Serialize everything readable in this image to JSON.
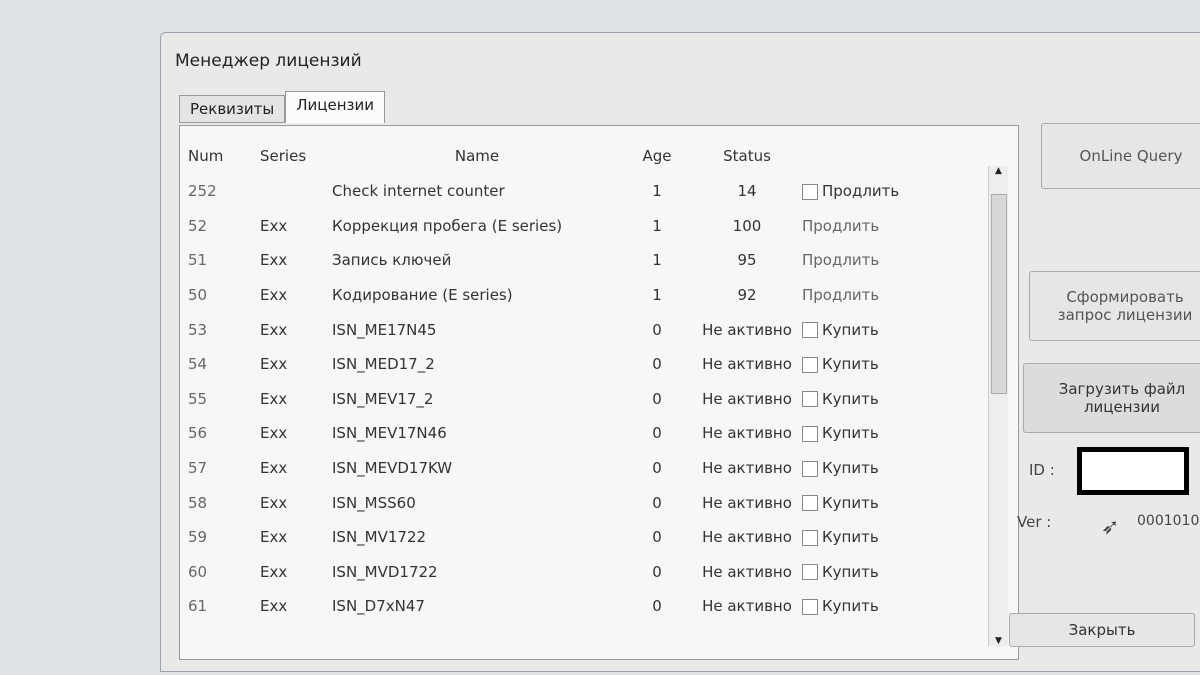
{
  "window": {
    "title": "Менеджер лицензий"
  },
  "tabs": [
    {
      "label": "Реквизиты"
    },
    {
      "label": "Лицензии"
    }
  ],
  "columns": {
    "num": "Num",
    "series": "Series",
    "name": "Name",
    "age": "Age",
    "status": "Status"
  },
  "rows": [
    {
      "num": "252",
      "series": "",
      "name": "Check internet counter",
      "age": "1",
      "status": "14",
      "action": "Продлить",
      "checkbox": true
    },
    {
      "num": "52",
      "series": "Exx",
      "name": "Коррекция пробега (E series)",
      "age": "1",
      "status": "100",
      "action": "Продлить",
      "checkbox": false
    },
    {
      "num": "51",
      "series": "Exx",
      "name": "Запись ключей",
      "age": "1",
      "status": "95",
      "action": "Продлить",
      "checkbox": false
    },
    {
      "num": "50",
      "series": "Exx",
      "name": "Кодирование (E series)",
      "age": "1",
      "status": "92",
      "action": "Продлить",
      "checkbox": false
    },
    {
      "num": "53",
      "series": "Exx",
      "name": "ISN_ME17N45",
      "age": "0",
      "status": "Не активно",
      "action": "Купить",
      "checkbox": true
    },
    {
      "num": "54",
      "series": "Exx",
      "name": "ISN_MED17_2",
      "age": "0",
      "status": "Не активно",
      "action": "Купить",
      "checkbox": true
    },
    {
      "num": "55",
      "series": "Exx",
      "name": "ISN_MEV17_2",
      "age": "0",
      "status": "Не активно",
      "action": "Купить",
      "checkbox": true
    },
    {
      "num": "56",
      "series": "Exx",
      "name": "ISN_MEV17N46",
      "age": "0",
      "status": "Не активно",
      "action": "Купить",
      "checkbox": true
    },
    {
      "num": "57",
      "series": "Exx",
      "name": "ISN_MEVD17KW",
      "age": "0",
      "status": "Не активно",
      "action": "Купить",
      "checkbox": true
    },
    {
      "num": "58",
      "series": "Exx",
      "name": "ISN_MSS60",
      "age": "0",
      "status": "Не активно",
      "action": "Купить",
      "checkbox": true
    },
    {
      "num": "59",
      "series": "Exx",
      "name": "ISN_MV1722",
      "age": "0",
      "status": "Не активно",
      "action": "Купить",
      "checkbox": true
    },
    {
      "num": "60",
      "series": "Exx",
      "name": "ISN_MVD1722",
      "age": "0",
      "status": "Не активно",
      "action": "Купить",
      "checkbox": true
    },
    {
      "num": "61",
      "series": "Exx",
      "name": "ISN_D7xN47",
      "age": "0",
      "status": "Не активно",
      "action": "Купить",
      "checkbox": true
    }
  ],
  "buttons": {
    "online": "OnLine Query",
    "request": "Сформировать запрос лицензии",
    "load": "Загрузить файл лицензии",
    "close": "Закрыть"
  },
  "info": {
    "id_label": "ID :",
    "ver_label": "Ver :",
    "ver_value": "0001010"
  }
}
